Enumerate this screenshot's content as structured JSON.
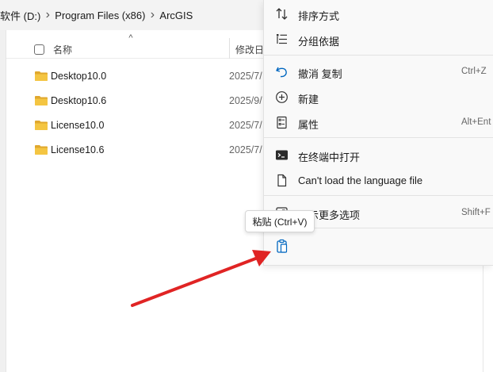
{
  "breadcrumb": {
    "items": [
      "软件 (D:)",
      "Program Files (x86)",
      "ArcGIS"
    ]
  },
  "file_list": {
    "header": {
      "name_label": "名称",
      "date_label": "修改日期"
    },
    "rows": [
      {
        "name": "Desktop10.0",
        "date": "2025/7/"
      },
      {
        "name": "Desktop10.6",
        "date": "2025/9/"
      },
      {
        "name": "License10.0",
        "date": "2025/7/"
      },
      {
        "name": "License10.6",
        "date": "2025/7/"
      }
    ]
  },
  "context_menu": {
    "items": [
      {
        "label": "排序方式",
        "icon": "sort-icon",
        "shortcut": ""
      },
      {
        "label": "分组依据",
        "icon": "group-by-icon",
        "shortcut": ""
      },
      {
        "label": "撤消 复制",
        "icon": "undo-icon",
        "shortcut": "Ctrl+Z"
      },
      {
        "label": "新建",
        "icon": "new-plus-icon",
        "shortcut": ""
      },
      {
        "label": "属性",
        "icon": "properties-icon",
        "shortcut": "Alt+Ent"
      },
      {
        "label": "在终端中打开",
        "icon": "terminal-icon",
        "shortcut": ""
      },
      {
        "label": "Can't load the language file",
        "icon": "file-icon",
        "shortcut": ""
      },
      {
        "label": "显示更多选项",
        "icon": "more-options-icon",
        "shortcut": "Shift+F"
      }
    ],
    "paste_icon": "paste-icon"
  },
  "tooltip": {
    "text": "粘贴 (Ctrl+V)"
  },
  "colors": {
    "folder": "#f4c542",
    "folder_dark": "#e0a82e",
    "arrow": "#e02424",
    "accent": "#0067c0"
  }
}
